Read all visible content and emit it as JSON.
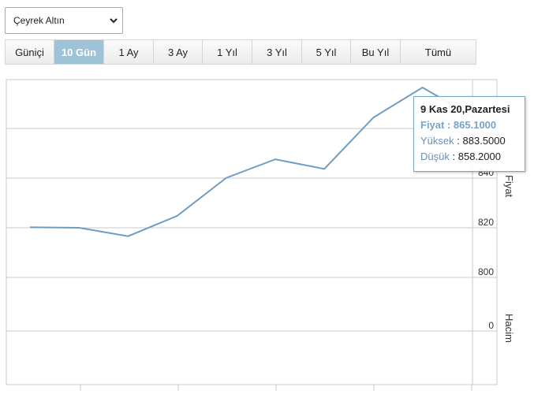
{
  "select": {
    "value": "Çeyrek Altın"
  },
  "tabs": [
    {
      "label": "Güniçi",
      "active": false
    },
    {
      "label": "10 Gün",
      "active": true
    },
    {
      "label": "1 Ay",
      "active": false
    },
    {
      "label": "3 Ay",
      "active": false
    },
    {
      "label": "1 Yıl",
      "active": false
    },
    {
      "label": "3 Yıl",
      "active": false
    },
    {
      "label": "5 Yıl",
      "active": false
    },
    {
      "label": "Bu Yıl",
      "active": false
    },
    {
      "label": "Tümü",
      "active": false
    }
  ],
  "chart_data": {
    "type": "line",
    "ylabel": "Fiyat",
    "volume_label": "Hacim",
    "y_ticks": [
      820,
      840,
      800
    ],
    "y_ticks_display": [
      "840",
      "820",
      "800"
    ],
    "volume_tick": "0",
    "ylim": [
      780,
      880
    ],
    "grid": true,
    "series": [
      {
        "values": [
          820.2,
          820.0,
          816.6,
          824.8,
          840.1,
          847.6,
          843.7,
          864.4,
          876.5,
          865.1
        ]
      }
    ],
    "line_color": "#6f9cc3"
  },
  "tooltip": {
    "title": "9 Kas 20,Pazartesi",
    "price_label": "Fiyat",
    "price_value": "865.1000",
    "high_label": "Yüksek",
    "high_value": "883.5000",
    "low_label": "Düşük",
    "low_value": "858.2000"
  }
}
